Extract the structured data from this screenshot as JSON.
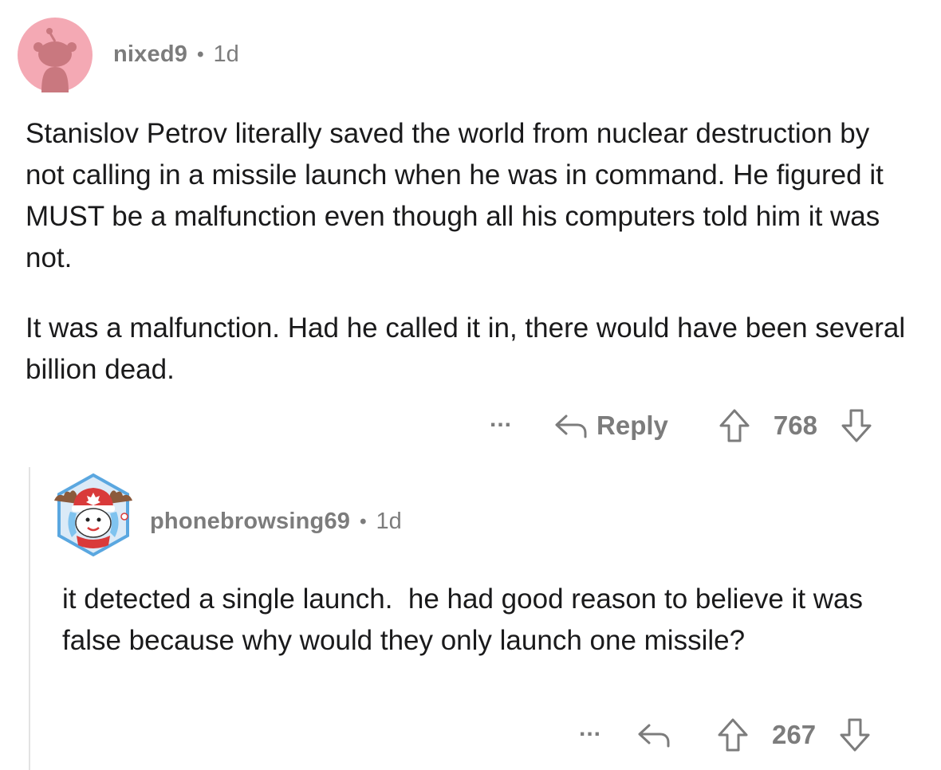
{
  "comment": {
    "author": "nixed9",
    "separator": "•",
    "age": "1d",
    "paragraphs": [
      "Stanislov Petrov literally saved the world from nuclear destruction by not calling in a missile launch when he was in command. He figured it MUST be a malfunction even though all his computers told him it was not.",
      "It was a malfunction. Had he called it in, there would have been several billion dead."
    ],
    "more_label": "...",
    "reply_label": "Reply",
    "votes": "768",
    "avatar_colors": {
      "background": "#f4a9b4",
      "figure": "#c9787f"
    }
  },
  "reply": {
    "author": "phonebrowsing69",
    "separator": "•",
    "age": "1d",
    "paragraphs": [
      "it detected a single launch.  he had good reason to believe it was false because why would they only launch one missile?"
    ],
    "more_label": "...",
    "votes": "267",
    "avatar_colors": {
      "hat": "#d93a3a",
      "antler": "#8b5a3c",
      "frame": "#5aa7e0",
      "face": "#ffffff"
    }
  }
}
